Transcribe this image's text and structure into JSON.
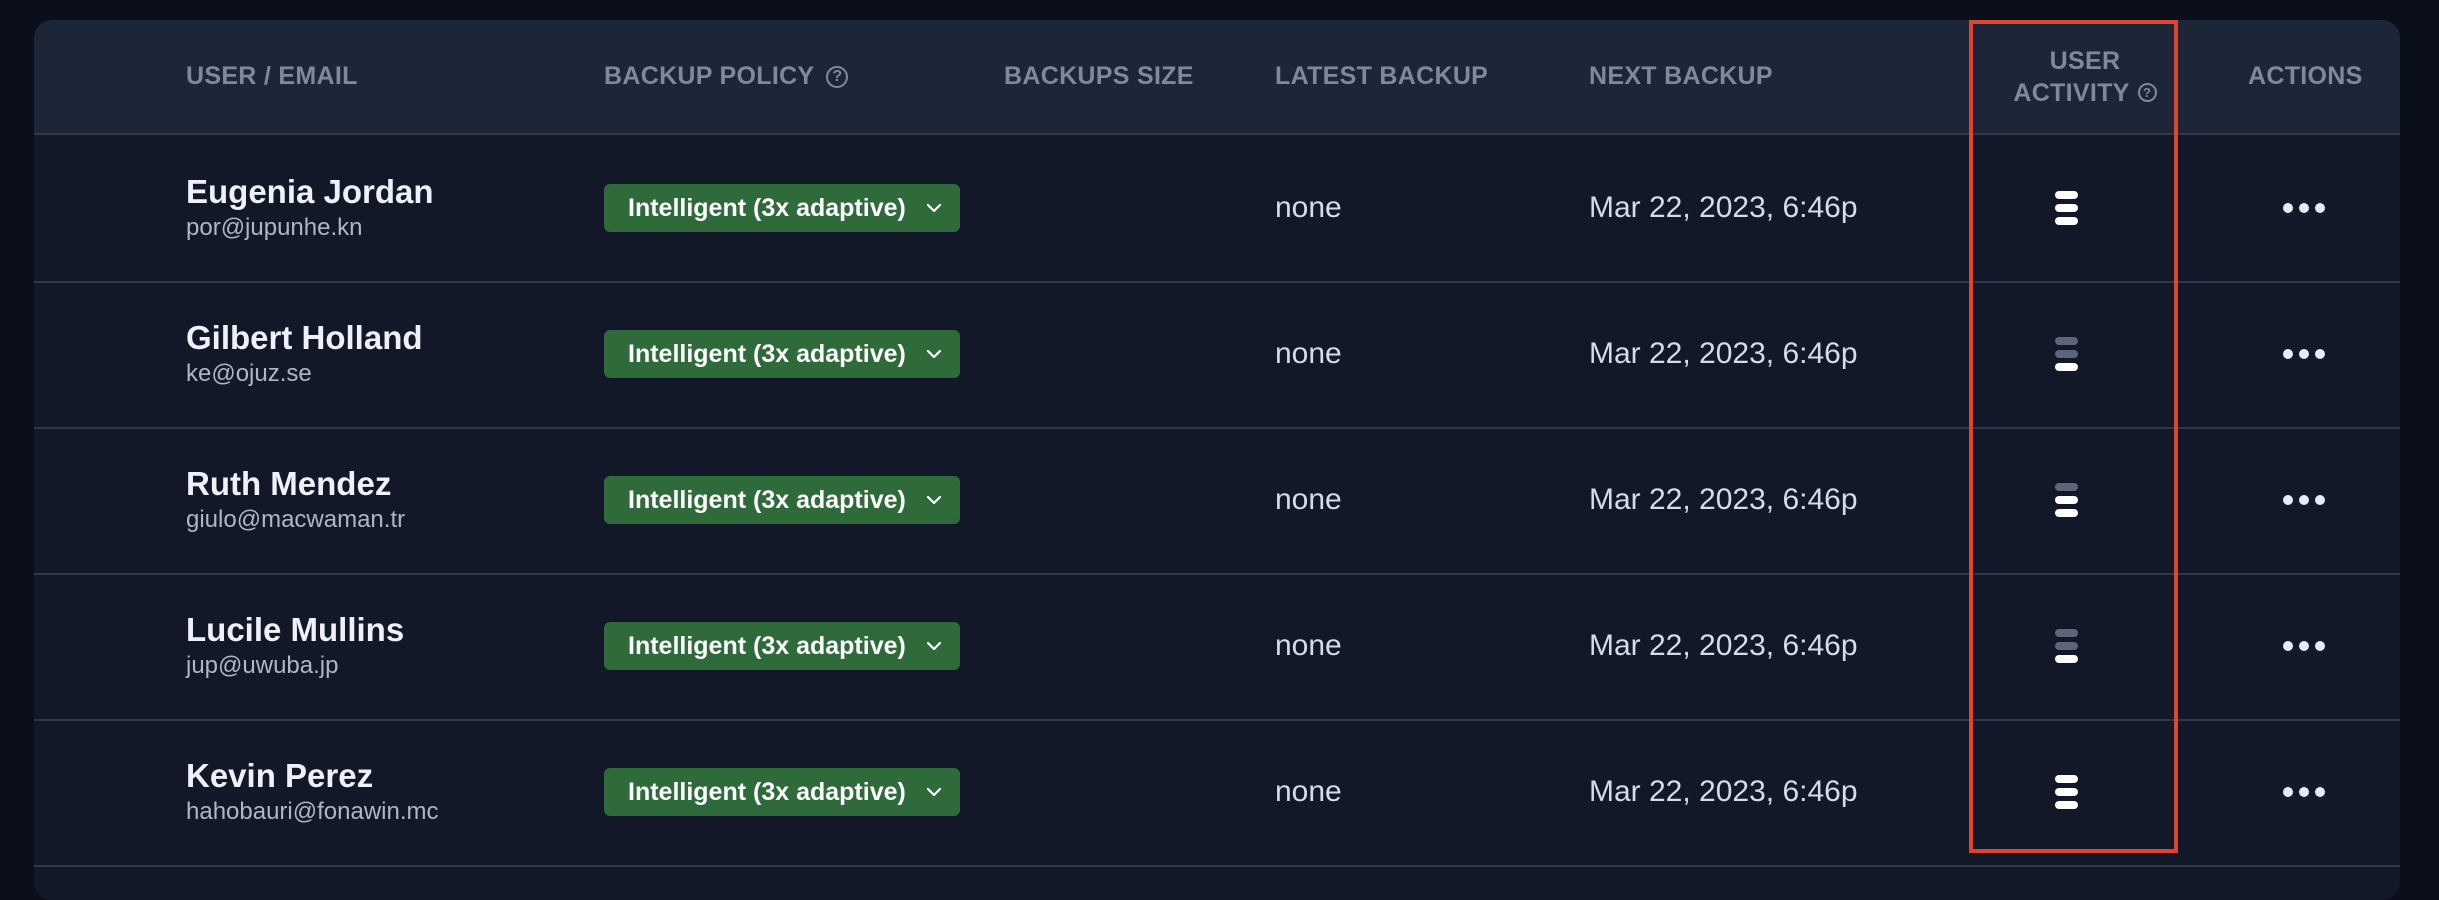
{
  "table": {
    "columns": {
      "user": "USER / EMAIL",
      "policy": "BACKUP POLICY",
      "size": "BACKUPS SIZE",
      "latest": "LATEST BACKUP",
      "next": "NEXT BACKUP",
      "activity_line1": "USER",
      "activity_line2": "ACTIVITY",
      "actions": "ACTIONS"
    },
    "help_icon_glyph": "?",
    "rows": [
      {
        "name": "Eugenia Jordan",
        "email": "por@jupunhe.kn",
        "policy": "Intelligent (3x adaptive)",
        "size": "",
        "latest": "none",
        "next": "Mar 22, 2023, 6:46p",
        "activity_level": 3
      },
      {
        "name": "Gilbert Holland",
        "email": "ke@ojuz.se",
        "policy": "Intelligent (3x adaptive)",
        "size": "",
        "latest": "none",
        "next": "Mar 22, 2023, 6:46p",
        "activity_level": 1
      },
      {
        "name": "Ruth Mendez",
        "email": "giulo@macwaman.tr",
        "policy": "Intelligent (3x adaptive)",
        "size": "",
        "latest": "none",
        "next": "Mar 22, 2023, 6:46p",
        "activity_level": 2
      },
      {
        "name": "Lucile Mullins",
        "email": "jup@uwuba.jp",
        "policy": "Intelligent (3x adaptive)",
        "size": "",
        "latest": "none",
        "next": "Mar 22, 2023, 6:46p",
        "activity_level": 1
      },
      {
        "name": "Kevin Perez",
        "email": "hahobauri@fonawin.mc",
        "policy": "Intelligent (3x adaptive)",
        "size": "",
        "latest": "none",
        "next": "Mar 22, 2023, 6:46p",
        "activity_level": 3
      }
    ]
  },
  "colors": {
    "background": "#0b0f1b",
    "table": "#121828",
    "header": "#1d2637",
    "policy_badge": "#2f6a3b",
    "highlight": "#e0442e"
  },
  "icons": {
    "help": "help-circle-icon",
    "chevron": "chevron-down-icon",
    "activity": "activity-bars-icon",
    "actions": "more-horizontal-icon"
  }
}
